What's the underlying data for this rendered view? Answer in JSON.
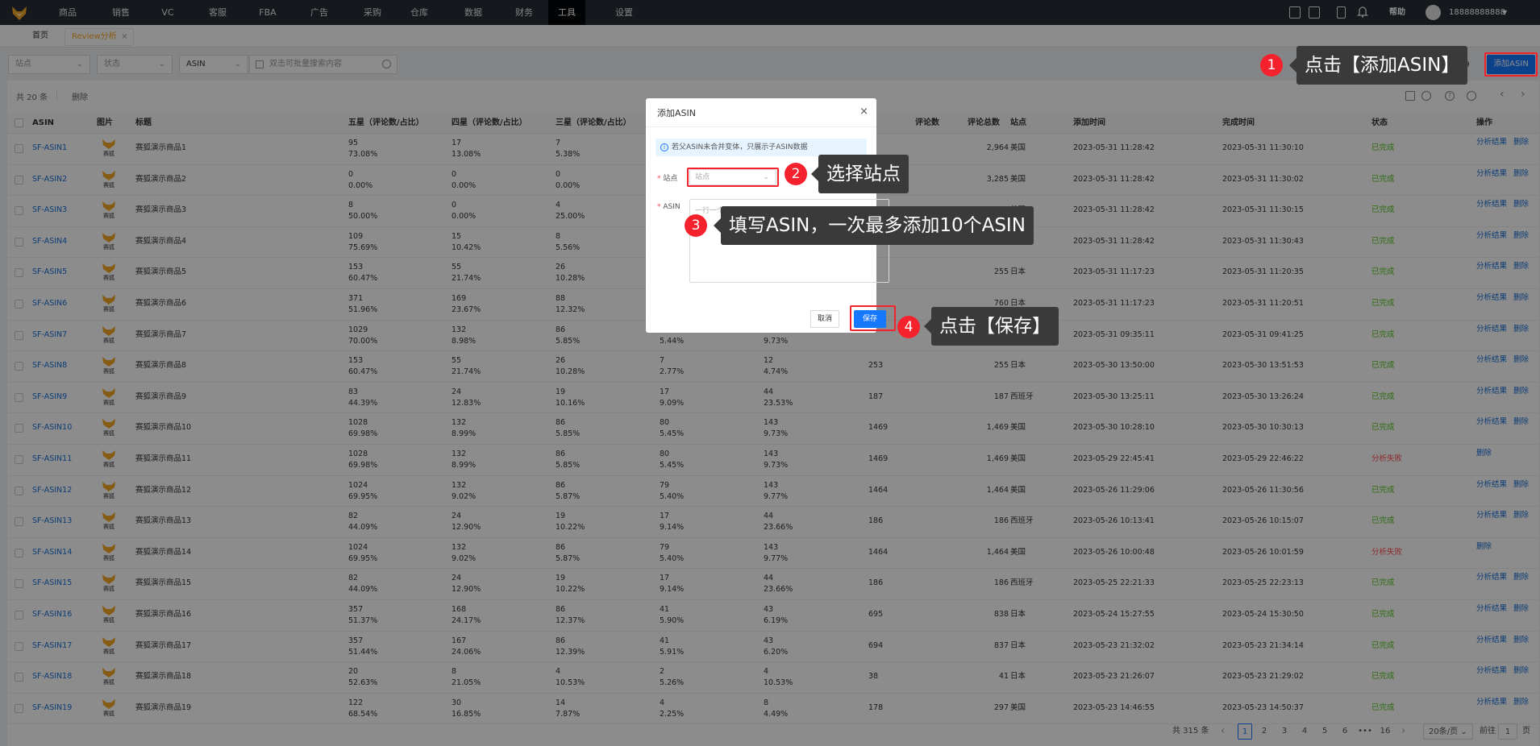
{
  "nav": {
    "items": [
      "商品",
      "销售",
      "VC",
      "客服",
      "FBA",
      "广告",
      "采购",
      "仓库",
      "数据",
      "财务",
      "工具",
      "设置"
    ],
    "active": "工具",
    "help": "帮助",
    "user": "18888888888"
  },
  "tabs": [
    "首页",
    "Review分析"
  ],
  "filters": {
    "site": "站点",
    "status": "状态",
    "type": "ASIN",
    "search_placeholder": "双击可批量搜索内容"
  },
  "add_button": "添加ASIN",
  "table": {
    "total": "共 20 条",
    "delete": "删除",
    "headers": [
      "ASIN",
      "图片",
      "标题",
      "五星（评论数/占比）",
      "四星（评论数/占比）",
      "三星（评论数/占比）",
      "评论数",
      "评论总数",
      "站点",
      "添加时间",
      "完成时间",
      "状态",
      "操作"
    ],
    "thumb_text": "赛狐",
    "action_result": "分析结果",
    "action_delete": "删除",
    "rows": [
      {
        "asin": "SF-ASIN1",
        "title": "赛狐演示商品1",
        "s5": "95",
        "p5": "73.08%",
        "s4": "17",
        "p4": "13.08%",
        "s3": "7",
        "p3": "5.38%",
        "s2": "",
        "p2": "",
        "s1": "",
        "p1": "",
        "rc": "",
        "total": "2,964",
        "site": "美国",
        "added": "2023-05-31 11:28:42",
        "done": "2023-05-31 11:30:10",
        "status": "已完成",
        "ok": true
      },
      {
        "asin": "SF-ASIN2",
        "title": "赛狐演示商品2",
        "s5": "0",
        "p5": "0.00%",
        "s4": "0",
        "p4": "0.00%",
        "s3": "0",
        "p3": "0.00%",
        "s2": "",
        "p2": "",
        "s1": "",
        "p1": "",
        "rc": "",
        "total": "3,285",
        "site": "美国",
        "added": "2023-05-31 11:28:42",
        "done": "2023-05-31 11:30:02",
        "status": "已完成",
        "ok": true
      },
      {
        "asin": "SF-ASIN3",
        "title": "赛狐演示商品3",
        "s5": "8",
        "p5": "50.00%",
        "s4": "0",
        "p4": "0.00%",
        "s3": "4",
        "p3": "25.00%",
        "s2": "",
        "p2": "",
        "s1": "",
        "p1": "",
        "rc": "",
        "total": "16",
        "site": "美国",
        "added": "2023-05-31 11:28:42",
        "done": "2023-05-31 11:30:15",
        "status": "已完成",
        "ok": true
      },
      {
        "asin": "SF-ASIN4",
        "title": "赛狐演示商品4",
        "s5": "109",
        "p5": "75.69%",
        "s4": "15",
        "p4": "10.42%",
        "s3": "8",
        "p3": "5.56%",
        "s2": "",
        "p2": "",
        "s1": "",
        "p1": "",
        "rc": "",
        "total": "218",
        "site": "美国",
        "added": "2023-05-31 11:28:42",
        "done": "2023-05-31 11:30:43",
        "status": "已完成",
        "ok": true
      },
      {
        "asin": "SF-ASIN5",
        "title": "赛狐演示商品5",
        "s5": "153",
        "p5": "60.47%",
        "s4": "55",
        "p4": "21.74%",
        "s3": "26",
        "p3": "10.28%",
        "s2": "",
        "p2": "",
        "s1": "",
        "p1": "",
        "rc": "",
        "total": "255",
        "site": "日本",
        "added": "2023-05-31 11:17:23",
        "done": "2023-05-31 11:20:35",
        "status": "已完成",
        "ok": true
      },
      {
        "asin": "SF-ASIN6",
        "title": "赛狐演示商品6",
        "s5": "371",
        "p5": "51.96%",
        "s4": "169",
        "p4": "23.67%",
        "s3": "88",
        "p3": "12.32%",
        "s2": "",
        "p2": "",
        "s1": "",
        "p1": "",
        "rc": "",
        "total": "760",
        "site": "日本",
        "added": "2023-05-31 11:17:23",
        "done": "2023-05-31 11:20:51",
        "status": "已完成",
        "ok": true
      },
      {
        "asin": "SF-ASIN7",
        "title": "赛狐演示商品7",
        "s5": "1029",
        "p5": "70.00%",
        "s4": "132",
        "p4": "8.98%",
        "s3": "86",
        "p3": "5.85%",
        "s2": "",
        "p2": "5.44%",
        "s1": "",
        "p1": "9.73%",
        "rc": "",
        "total": "",
        "site": "",
        "added": "2023-05-31 09:35:11",
        "done": "2023-05-31 09:41:25",
        "status": "已完成",
        "ok": true
      },
      {
        "asin": "SF-ASIN8",
        "title": "赛狐演示商品8",
        "s5": "153",
        "p5": "60.47%",
        "s4": "55",
        "p4": "21.74%",
        "s3": "26",
        "p3": "10.28%",
        "s2": "7",
        "p2": "2.77%",
        "s1": "12",
        "p1": "4.74%",
        "rc": "253",
        "total": "255",
        "site": "日本",
        "added": "2023-05-30 13:50:00",
        "done": "2023-05-30 13:51:53",
        "status": "已完成",
        "ok": true
      },
      {
        "asin": "SF-ASIN9",
        "title": "赛狐演示商品9",
        "s5": "83",
        "p5": "44.39%",
        "s4": "24",
        "p4": "12.83%",
        "s3": "19",
        "p3": "10.16%",
        "s2": "17",
        "p2": "9.09%",
        "s1": "44",
        "p1": "23.53%",
        "rc": "187",
        "total": "187",
        "site": "西班牙",
        "added": "2023-05-30 13:25:11",
        "done": "2023-05-30 13:26:24",
        "status": "已完成",
        "ok": true
      },
      {
        "asin": "SF-ASIN10",
        "title": "赛狐演示商品10",
        "s5": "1028",
        "p5": "69.98%",
        "s4": "132",
        "p4": "8.99%",
        "s3": "86",
        "p3": "5.85%",
        "s2": "80",
        "p2": "5.45%",
        "s1": "143",
        "p1": "9.73%",
        "rc": "1469",
        "total": "1,469",
        "site": "美国",
        "added": "2023-05-30 10:28:10",
        "done": "2023-05-30 10:30:13",
        "status": "已完成",
        "ok": true
      },
      {
        "asin": "SF-ASIN11",
        "title": "赛狐演示商品11",
        "s5": "1028",
        "p5": "69.98%",
        "s4": "132",
        "p4": "8.99%",
        "s3": "86",
        "p3": "5.85%",
        "s2": "80",
        "p2": "5.45%",
        "s1": "143",
        "p1": "9.73%",
        "rc": "1469",
        "total": "1,469",
        "site": "美国",
        "added": "2023-05-29 22:45:41",
        "done": "2023-05-29 22:46:22",
        "status": "分析失败",
        "ok": false
      },
      {
        "asin": "SF-ASIN12",
        "title": "赛狐演示商品12",
        "s5": "1024",
        "p5": "69.95%",
        "s4": "132",
        "p4": "9.02%",
        "s3": "86",
        "p3": "5.87%",
        "s2": "79",
        "p2": "5.40%",
        "s1": "143",
        "p1": "9.77%",
        "rc": "1464",
        "total": "1,464",
        "site": "美国",
        "added": "2023-05-26 11:29:06",
        "done": "2023-05-26 11:30:56",
        "status": "已完成",
        "ok": true
      },
      {
        "asin": "SF-ASIN13",
        "title": "赛狐演示商品13",
        "s5": "82",
        "p5": "44.09%",
        "s4": "24",
        "p4": "12.90%",
        "s3": "19",
        "p3": "10.22%",
        "s2": "17",
        "p2": "9.14%",
        "s1": "44",
        "p1": "23.66%",
        "rc": "186",
        "total": "186",
        "site": "西班牙",
        "added": "2023-05-26 10:13:41",
        "done": "2023-05-26 10:15:07",
        "status": "已完成",
        "ok": true
      },
      {
        "asin": "SF-ASIN14",
        "title": "赛狐演示商品14",
        "s5": "1024",
        "p5": "69.95%",
        "s4": "132",
        "p4": "9.02%",
        "s3": "86",
        "p3": "5.87%",
        "s2": "79",
        "p2": "5.40%",
        "s1": "143",
        "p1": "9.77%",
        "rc": "1464",
        "total": "1,464",
        "site": "美国",
        "added": "2023-05-26 10:00:48",
        "done": "2023-05-26 10:01:59",
        "status": "分析失败",
        "ok": false
      },
      {
        "asin": "SF-ASIN15",
        "title": "赛狐演示商品15",
        "s5": "82",
        "p5": "44.09%",
        "s4": "24",
        "p4": "12.90%",
        "s3": "19",
        "p3": "10.22%",
        "s2": "17",
        "p2": "9.14%",
        "s1": "44",
        "p1": "23.66%",
        "rc": "186",
        "total": "186",
        "site": "西班牙",
        "added": "2023-05-25 22:21:33",
        "done": "2023-05-25 22:23:13",
        "status": "已完成",
        "ok": true
      },
      {
        "asin": "SF-ASIN16",
        "title": "赛狐演示商品16",
        "s5": "357",
        "p5": "51.37%",
        "s4": "168",
        "p4": "24.17%",
        "s3": "86",
        "p3": "12.37%",
        "s2": "41",
        "p2": "5.90%",
        "s1": "43",
        "p1": "6.19%",
        "rc": "695",
        "total": "838",
        "site": "日本",
        "added": "2023-05-24 15:27:55",
        "done": "2023-05-24 15:30:50",
        "status": "已完成",
        "ok": true
      },
      {
        "asin": "SF-ASIN17",
        "title": "赛狐演示商品17",
        "s5": "357",
        "p5": "51.44%",
        "s4": "167",
        "p4": "24.06%",
        "s3": "86",
        "p3": "12.39%",
        "s2": "41",
        "p2": "5.91%",
        "s1": "43",
        "p1": "6.20%",
        "rc": "694",
        "total": "837",
        "site": "日本",
        "added": "2023-05-23 21:32:02",
        "done": "2023-05-23 21:34:14",
        "status": "已完成",
        "ok": true
      },
      {
        "asin": "SF-ASIN18",
        "title": "赛狐演示商品18",
        "s5": "20",
        "p5": "52.63%",
        "s4": "8",
        "p4": "21.05%",
        "s3": "4",
        "p3": "10.53%",
        "s2": "2",
        "p2": "5.26%",
        "s1": "4",
        "p1": "10.53%",
        "rc": "38",
        "total": "41",
        "site": "日本",
        "added": "2023-05-23 21:26:07",
        "done": "2023-05-23 21:29:02",
        "status": "已完成",
        "ok": true
      },
      {
        "asin": "SF-ASIN19",
        "title": "赛狐演示商品19",
        "s5": "122",
        "p5": "68.54%",
        "s4": "30",
        "p4": "16.85%",
        "s3": "14",
        "p3": "7.87%",
        "s2": "4",
        "p2": "2.25%",
        "s1": "8",
        "p1": "4.49%",
        "rc": "178",
        "total": "297",
        "site": "美国",
        "added": "2023-05-23 14:46:55",
        "done": "2023-05-23 14:50:37",
        "status": "已完成",
        "ok": true
      }
    ]
  },
  "pagination": {
    "total": "共 315 条",
    "pages": [
      "1",
      "2",
      "3",
      "4",
      "5",
      "6",
      "•••",
      "16"
    ],
    "page_size": "20条/页",
    "goto": "前往",
    "goto_value": "1",
    "page_unit": "页",
    "partial_count": "19"
  },
  "modal": {
    "title": "添加ASIN",
    "info": "若父ASIN未合并变体，只展示子ASIN数据",
    "site_label": "站点",
    "site_placeholder": "站点",
    "asin_label": "ASIN",
    "asin_placeholder": "一行一个ASIN，可换行输入内容",
    "cancel": "取消",
    "save": "保存"
  },
  "annotations": [
    {
      "num": "1",
      "text": "点击【添加ASIN】"
    },
    {
      "num": "2",
      "text": "选择站点"
    },
    {
      "num": "3",
      "text": "填写ASIN，一次最多添加10个ASIN"
    },
    {
      "num": "4",
      "text": "点击【保存】"
    }
  ],
  "colors": {
    "nav_bg": "#272c36",
    "primary": "#1677ff",
    "success": "#52c41a",
    "danger": "#ff4d4f",
    "highlight": "#f5222d",
    "callout_bg": "#3a3a3a"
  }
}
